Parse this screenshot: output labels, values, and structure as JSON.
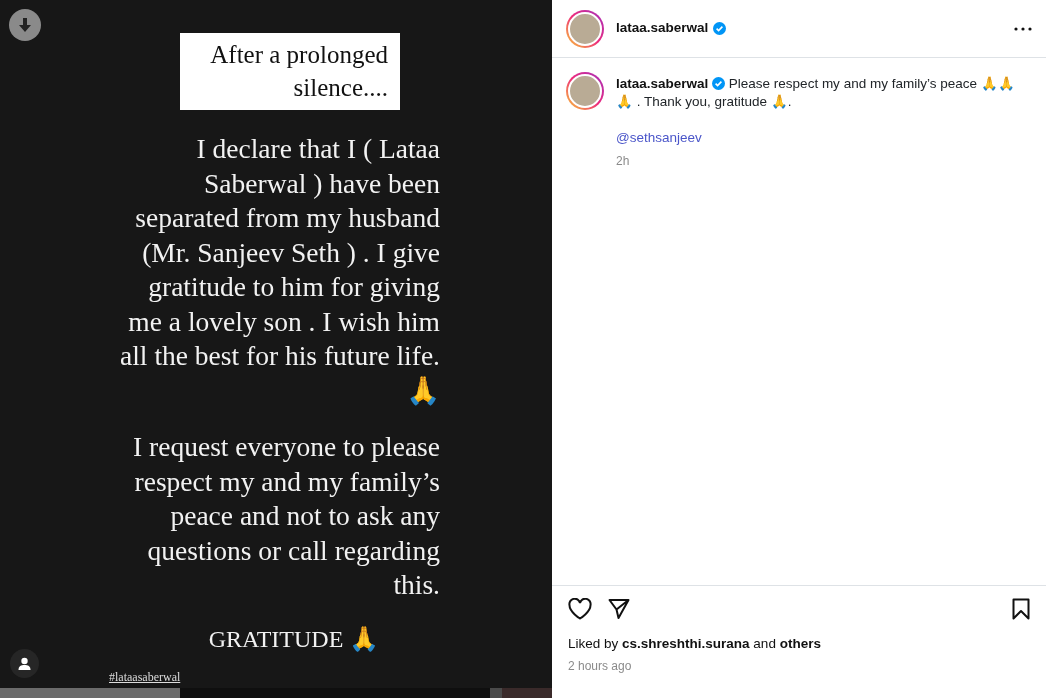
{
  "story": {
    "title": "After a prolonged silence....",
    "paragraphs": [
      "I declare that I ( Lataa Saberwal ) have been separated from my husband (Mr. Sanjeev Seth ) . I give gratitude to him for giving me a lovely son .  I wish him all the best for his future life. 🙏",
      "I request everyone to please  respect my and my family’s peace and not to ask any questions or call regarding this."
    ],
    "closing": "GRATITUDE 🙏",
    "hashtag": "#lataasaberwal"
  },
  "header": {
    "username": "lataa.saberwal",
    "verified": true
  },
  "caption": {
    "username": "lataa.saberwal",
    "verified": true,
    "text": "Please respect my and my family’s peace 🙏🙏🙏 . Thank you, gratitude 🙏.",
    "mention": "@sethsanjeev",
    "time": "2h"
  },
  "likes": {
    "prefix": "Liked by",
    "user": "cs.shreshthi.surana",
    "middle": "and",
    "suffix": "others"
  },
  "posted": "2 hours ago"
}
